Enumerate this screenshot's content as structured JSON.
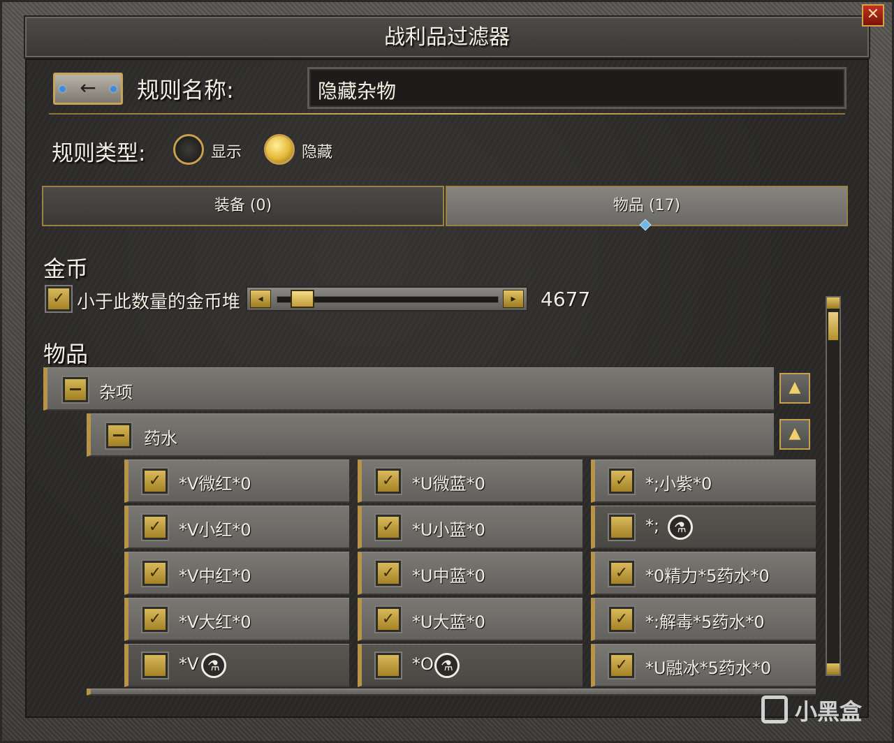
{
  "window": {
    "title": "战利品过滤器",
    "close_icon": "close-icon"
  },
  "rule_name": {
    "label": "规则名称:",
    "value": "隐藏杂物",
    "back_icon": "arrow-left-icon"
  },
  "rule_type": {
    "label": "规则类型:",
    "options": [
      {
        "label": "显示",
        "selected": false
      },
      {
        "label": "隐藏",
        "selected": true
      }
    ]
  },
  "tabs": [
    {
      "label": "装备 (0)",
      "active": false
    },
    {
      "label": "物品 (17)",
      "active": true
    }
  ],
  "gold": {
    "section_title": "金币",
    "checkbox_label": "小于此数量的金币堆",
    "checked": true,
    "value": "4677"
  },
  "items": {
    "section_title": "物品",
    "group": {
      "label": "杂项",
      "subgroup": {
        "label": "药水"
      }
    },
    "cells": [
      {
        "label": "*V微红*0",
        "checked": true
      },
      {
        "label": "*U微蓝*0",
        "checked": true
      },
      {
        "label": "*;小紫*0",
        "checked": true
      },
      {
        "label": "*V小红*0",
        "checked": true
      },
      {
        "label": "*U小蓝*0",
        "checked": true
      },
      {
        "label": "*;",
        "checked": false,
        "icon": "potion-icon"
      },
      {
        "label": "*V中红*0",
        "checked": true
      },
      {
        "label": "*U中蓝*0",
        "checked": true
      },
      {
        "label": "*0精力*5药水*0",
        "checked": true
      },
      {
        "label": "*V大红*0",
        "checked": true
      },
      {
        "label": "*U大蓝*0",
        "checked": true
      },
      {
        "label": "*:解毒*5药水*0",
        "checked": true
      },
      {
        "label": "*V",
        "checked": false,
        "icon": "potion-icon"
      },
      {
        "label": "*O",
        "checked": false,
        "icon": "potion-icon"
      },
      {
        "label": "*U融冰*5药水*0",
        "checked": true
      }
    ]
  },
  "watermark": "小黑盒"
}
